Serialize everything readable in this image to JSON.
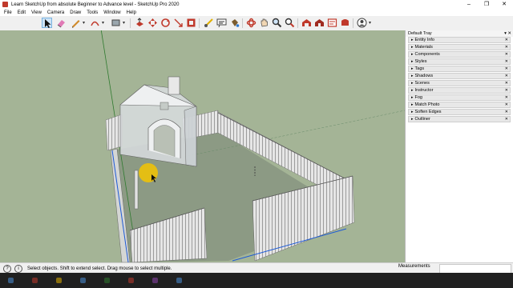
{
  "window": {
    "title": "Learn SketchUp from absolute  Beginner to Advance level - SketchUp Pro 2020",
    "minimize_glyph": "–",
    "restore_glyph": "❐",
    "close_glyph": "✕"
  },
  "menu": [
    "File",
    "Edit",
    "View",
    "Camera",
    "Draw",
    "Tools",
    "Window",
    "Help"
  ],
  "toolbar": {
    "icons": [
      "cursor-icon",
      "eraser-icon",
      "pencil-icon",
      "arc-icon",
      "rectangle-icon",
      "pushpull-icon",
      "move-icon",
      "rotate-icon",
      "scale-icon",
      "offset-icon",
      "tape-measure-icon",
      "text-icon",
      "paint-bucket-icon",
      "orbit-icon",
      "pan-icon",
      "zoom-icon",
      "zoom-extents-icon",
      "warehouse-icon",
      "extension-warehouse-icon",
      "layout-icon",
      "extension-manager-icon",
      "account-icon"
    ],
    "caret_glyph": "▾"
  },
  "tray": {
    "title": "Default Tray",
    "controls": "▾ ✕",
    "expand_glyph": "▸",
    "close_glyph": "✕",
    "panels": [
      "Entity Info",
      "Materials",
      "Components",
      "Styles",
      "Tags",
      "Shadows",
      "Scenes",
      "Instructor",
      "Fog",
      "Match Photo",
      "Soften Edges",
      "Outliner"
    ]
  },
  "status": {
    "help_glyph": "?",
    "info_glyph": "i",
    "message": "Select objects. Shift to extend select. Drag mouse to select multiple.",
    "measurements_label": "Measurements",
    "measurements_value": ""
  },
  "colors": {
    "sky": "#a7b698",
    "ground": "#8d9a85",
    "accent_blue": "#1e5bd6",
    "cursor_highlight": "#f3c400"
  }
}
